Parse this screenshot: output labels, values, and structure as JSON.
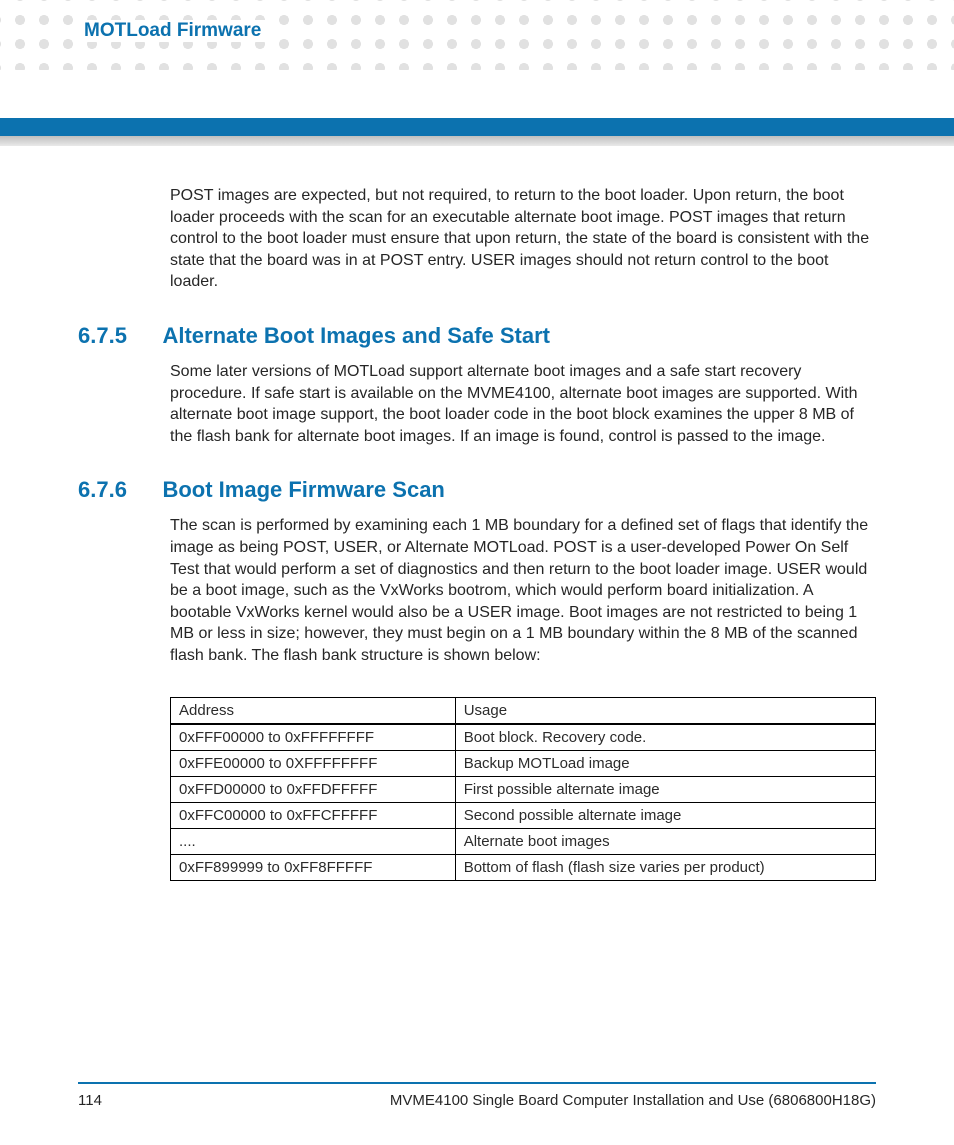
{
  "header": {
    "title": "MOTLoad Firmware"
  },
  "intro_para": "POST images are expected, but not required, to return to the boot loader. Upon return, the boot loader proceeds with the scan for an executable alternate boot image. POST images that return control to the boot loader must ensure that upon return, the state of the board is consistent with the state that the board was in at POST entry. USER images should not return control to the boot loader.",
  "sections": [
    {
      "num": "6.7.5",
      "title": "Alternate Boot Images and Safe Start",
      "para": "Some later versions of MOTLoad support alternate boot images and a safe start recovery procedure. If safe start is available on the MVME4100, alternate boot images are supported. With alternate boot image support, the boot loader code in the boot block examines the upper 8 MB of the flash bank for alternate boot images. If an image is found, control is passed to the image."
    },
    {
      "num": "6.7.6",
      "title": "Boot Image Firmware Scan",
      "para": "The scan is performed by examining each 1 MB boundary for a defined set of flags that identify the image as being POST, USER, or Alternate MOTLoad. POST is a user-developed Power On Self Test that would perform a set of diagnostics and then return to the boot loader image. USER would be a boot image, such as the VxWorks bootrom, which would perform board initialization. A bootable VxWorks kernel would also be a USER image. Boot images are not restricted to being 1 MB or less in size; however, they must begin on a 1 MB boundary within the 8 MB of the scanned flash bank. The flash bank structure is shown below:"
    }
  ],
  "table": {
    "headers": [
      "Address",
      "Usage"
    ],
    "rows": [
      [
        "0xFFF00000 to 0xFFFFFFFF",
        "Boot block. Recovery code."
      ],
      [
        "0xFFE00000 to 0XFFFFFFFF",
        "Backup MOTLoad image"
      ],
      [
        "0xFFD00000 to 0xFFDFFFFF",
        "First possible alternate image"
      ],
      [
        "0xFFC00000 to 0xFFCFFFFF",
        "Second possible alternate image"
      ],
      [
        "....",
        "Alternate boot images"
      ],
      [
        "0xFF899999 to 0xFF8FFFFF",
        "Bottom of flash (flash size varies per product)"
      ]
    ]
  },
  "footer": {
    "page": "114",
    "text": "MVME4100 Single Board Computer Installation and Use (6806800H18G)"
  }
}
